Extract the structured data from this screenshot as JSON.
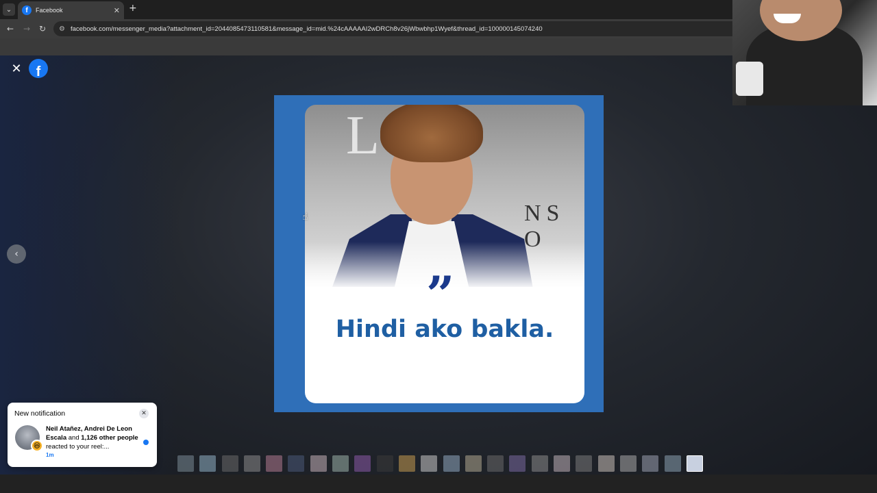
{
  "browser": {
    "tab_title": "Facebook",
    "tab_favicon": "f",
    "tab_list_icon": "chevron-down",
    "tab_close": "✕",
    "new_tab": "+",
    "url": "facebook.com/messenger_media?attachment_id=2044085473110581&message_id=mid.%24cAAAAAI2wDRCh8v26jWbwbhp1Wyef&thread_id=100000145074240"
  },
  "viewer": {
    "close_icon": "✕",
    "logo": "f",
    "prev_icon": "‹",
    "media": {
      "quote_mark": "”",
      "quote_text": "Hindi ako bakla.",
      "background_letters_top": "LIN",
      "background_letters_side": "NS O"
    },
    "thumbnail_count": 24
  },
  "notification": {
    "heading": "New notification",
    "names": "Neil Atañez, Andrei De Leon Escala",
    "joiner": " and ",
    "others": "1,126 other people",
    "action": " reacted to your reel:...",
    "time": "1m",
    "reaction_icon": "😆",
    "close_icon": "✕"
  },
  "colors": {
    "facebook_blue": "#1877f2",
    "media_frame_blue": "#2f6fb8",
    "quote_text_blue": "#1f5fa3",
    "quote_mark_navy": "#1b3a8c"
  }
}
